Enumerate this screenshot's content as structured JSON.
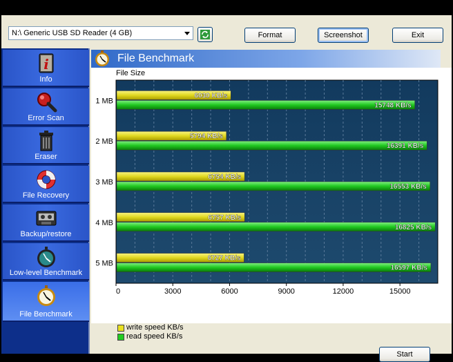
{
  "toolbar": {
    "drive_value": "N:\\ Generic USB  SD Reader (4 GB)",
    "format_label": "Format",
    "screenshot_label": "Screenshot",
    "exit_label": "Exit"
  },
  "sidebar": {
    "items": [
      {
        "label": "Info",
        "icon": "info-icon"
      },
      {
        "label": "Error Scan",
        "icon": "magnifier-icon"
      },
      {
        "label": "Eraser",
        "icon": "trash-icon"
      },
      {
        "label": "File Recovery",
        "icon": "lifebuoy-icon"
      },
      {
        "label": "Backup/restore",
        "icon": "tape-icon"
      },
      {
        "label": "Low-level Benchmark",
        "icon": "stopwatch-icon"
      },
      {
        "label": "File Benchmark",
        "icon": "stopwatch-icon"
      }
    ],
    "active_index": 6
  },
  "header": {
    "title": "File Benchmark"
  },
  "chart_data": {
    "type": "bar",
    "orientation": "horizontal",
    "ylabel": "File Size",
    "categories": [
      "1 MB",
      "2 MB",
      "3 MB",
      "4 MB",
      "5 MB"
    ],
    "series": [
      {
        "name": "write speed KB/s",
        "values": [
          6030,
          5794,
          6754,
          6757,
          6727
        ],
        "labels": [
          "6030 KB/s",
          "5794 KB/s",
          "6754 KB/s",
          "6757 KB/s",
          "6727 KB/s"
        ],
        "color": "#e8e020"
      },
      {
        "name": "read speed KB/s",
        "values": [
          15748,
          16391,
          16553,
          16825,
          16597
        ],
        "labels": [
          "15748 KB/s",
          "16391 KB/s",
          "16553 KB/s",
          "16825 KB/s",
          "16597 KB/s"
        ],
        "color": "#22cc22"
      }
    ],
    "xticks": [
      "0",
      "3000",
      "6000",
      "9000",
      "12000",
      "15000"
    ],
    "xlim": [
      0,
      17000
    ],
    "legend_position": "bottom-left",
    "grid": true,
    "background": "#1a3a5a"
  },
  "start_label": "Start"
}
